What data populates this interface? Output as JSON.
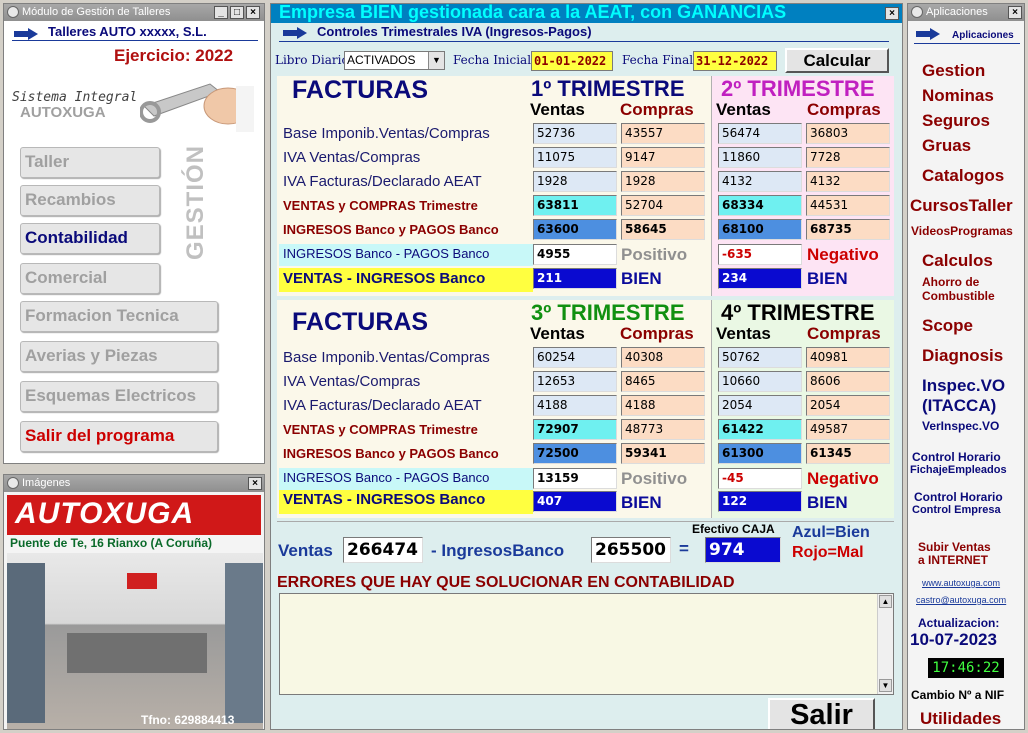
{
  "left_window": {
    "title": "Módulo de Gestión de Talleres",
    "company": "Talleres AUTO xxxxx, S.L.",
    "ejercicio": "Ejercicio: 2022",
    "brand_line1": "Sistema Integral",
    "brand_line2": "AUTOXUGA",
    "side_caption": "GESTIÓN",
    "nav": [
      "Taller",
      "Recambios",
      "Contabilidad",
      "Comercial",
      "Formacion Tecnica",
      "Averias y Piezas",
      "Esquemas Electricos",
      "Salir del programa"
    ]
  },
  "images_window": {
    "title": "Imágenes",
    "logo": "AUTOXUGA",
    "address": "Puente de Te, 16  Rianxo (A Coruña)",
    "phone": "Tfno: 629884413"
  },
  "main": {
    "banner": "Empresa BIEN gestionada cara a la AEAT, con GANANCIAS",
    "title": "Controles Trimestrales IVA (Ingresos-Pagos)",
    "libro_label": "Libro Diario",
    "libro_value": "ACTIVADOS",
    "fi_label": "Fecha Inicial",
    "fi_value": "01-01-2022",
    "ff_label": "Fecha Final",
    "ff_value": "31-12-2022",
    "calc_btn": "Calcular",
    "facturas": "FACTURAS",
    "ventas": "Ventas",
    "compras": "Compras",
    "row_labels": [
      "Base Imponib.Ventas/Compras",
      "IVA Ventas/Compras",
      "IVA Facturas/Declarado AEAT",
      "VENTAS y COMPRAS Trimestre",
      "INGRESOS Banco y PAGOS Banco",
      "INGRESOS Banco - PAGOS Banco",
      "VENTAS - INGRESOS Banco"
    ],
    "q": [
      {
        "title": "1º TRIMESTRE",
        "color": "#0a0a7a",
        "v": [
          "52736",
          "11075",
          "1928",
          "63811",
          "63600",
          "4955",
          "211"
        ],
        "c": [
          "43557",
          "9147",
          "1928",
          "52704",
          "58645"
        ],
        "status": "Positivo",
        "result": "BIEN"
      },
      {
        "title": "2º TRIMESTRE",
        "color": "#c020c0",
        "v": [
          "56474",
          "11860",
          "4132",
          "68334",
          "68100",
          "-635",
          "234"
        ],
        "c": [
          "36803",
          "7728",
          "4132",
          "44531",
          "68735"
        ],
        "status": "Negativo",
        "result": "BIEN"
      },
      {
        "title": "3º TRIMESTRE",
        "color": "#109010",
        "v": [
          "60254",
          "12653",
          "4188",
          "72907",
          "72500",
          "13159",
          "407"
        ],
        "c": [
          "40308",
          "8465",
          "4188",
          "48773",
          "59341"
        ],
        "status": "Positivo",
        "result": "BIEN"
      },
      {
        "title": "4º TRIMESTRE",
        "color": "#000000",
        "v": [
          "50762",
          "10660",
          "2054",
          "61422",
          "61300",
          "-45",
          "122"
        ],
        "c": [
          "40981",
          "8606",
          "2054",
          "49587",
          "61345"
        ],
        "status": "Negativo",
        "result": "BIEN"
      }
    ],
    "totals": {
      "ventas_label": "Ventas",
      "ventas": "266474",
      "ingresos_label": "- IngresosBanco",
      "ingresos": "265500",
      "eq": "=",
      "caja_label": "Efectivo CAJA",
      "caja": "974",
      "legend_blue": "Azul=Bien",
      "legend_red": "Rojo=Mal"
    },
    "errors_title": "ERRORES QUE HAY QUE SOLUCIONAR EN CONTABILIDAD",
    "salir_btn": "Salir"
  },
  "right_window": {
    "title": "Aplicaciones",
    "header": "Aplicaciones",
    "links": [
      "Gestion",
      "Nominas",
      "Seguros",
      "Gruas",
      "Catalogos",
      "CursosTaller",
      "VideosProgramas",
      "Calculos",
      "Ahorro de",
      "Combustible",
      "Scope",
      "Diagnosis",
      "Inspec.VO",
      "(ITACCA)",
      "VerInspec.VO",
      "Control Horario",
      "FichajeEmpleados",
      "Control Horario",
      "Control Empresa",
      "Subir Ventas",
      "a INTERNET"
    ],
    "web": "www.autoxuga.com",
    "email": "castro@autoxuga.com",
    "act_label": "Actualizacion:",
    "act_date": "10-07-2023",
    "clock": "17:46:22",
    "nif": "Cambio Nº a NIF",
    "utilidades": "Utilidades"
  }
}
